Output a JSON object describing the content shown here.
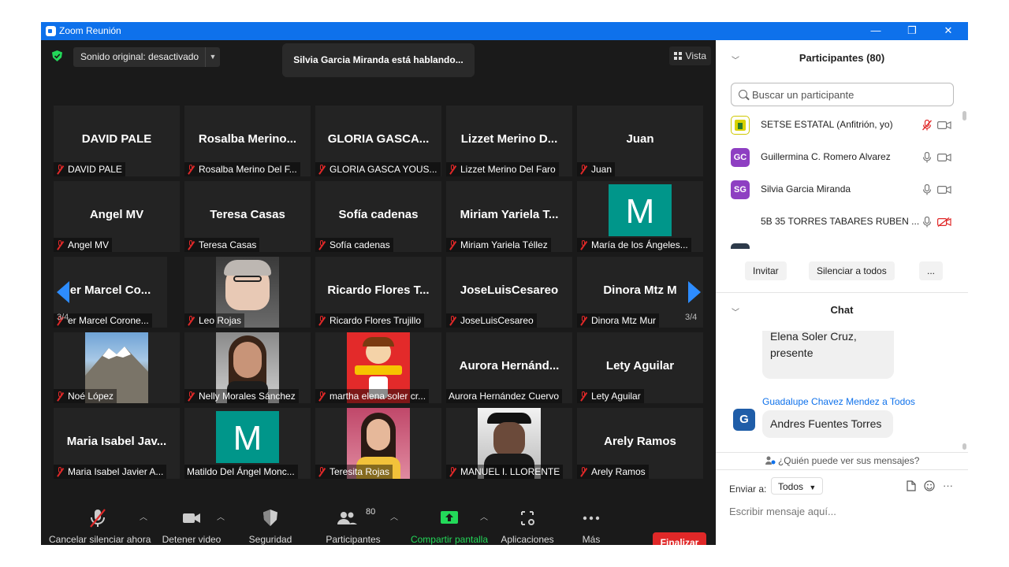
{
  "window": {
    "title": "Zoom Reunión",
    "minimize": "—",
    "maximize": "❐",
    "close": "✕"
  },
  "top": {
    "audio_label": "Sonido original: desactivado",
    "speaking": "Silvia Garcia Miranda está hablando...",
    "view_label": "Vista"
  },
  "tiles": [
    {
      "big": "DAVID PALE",
      "label": "DAVID PALE"
    },
    {
      "big": "Rosalba  Merino...",
      "label": "Rosalba Merino Del F..."
    },
    {
      "big": "GLORIA GASCA...",
      "label": "GLORIA GASCA YOUS..."
    },
    {
      "big": "Lizzet  Merino  D...",
      "label": "Lizzet Merino Del Faro"
    },
    {
      "big": "Juan",
      "label": "Juan"
    },
    {
      "big": "Angel MV",
      "label": "Angel MV"
    },
    {
      "big": "Teresa Casas",
      "label": "Teresa Casas"
    },
    {
      "big": "Sofía cadenas",
      "label": "Sofía cadenas"
    },
    {
      "big": "Miriam  Yariela  T...",
      "label": "Miriam Yariela Téllez"
    },
    {
      "letter": "M",
      "label": "María de los Ángeles..."
    },
    {
      "big": "er  Marcel  Co...",
      "label": "er Marcel Corone..."
    },
    {
      "photo": "leo",
      "label": "Leo Rojas"
    },
    {
      "big": "Ricardo  Flores  T...",
      "label": "Ricardo Flores Trujillo"
    },
    {
      "big": "JoseLuisCesareo",
      "label": "JoseLuisCesareo"
    },
    {
      "big": "Dinora  Mtz  M",
      "label": "Dinora Mtz Mur"
    },
    {
      "photo": "mountain",
      "label": "Noé López"
    },
    {
      "photo": "nelly",
      "label": "Nelly Morales Sánchez"
    },
    {
      "photo": "martha",
      "label": "martha elena soler cr..."
    },
    {
      "big": "Aurora  Hernánd...",
      "label": "Aurora Hernández Cuervo",
      "unmuted": true
    },
    {
      "big": "Lety Aguilar",
      "label": "Lety Aguilar"
    },
    {
      "big": "Maria  Isabel  Jav...",
      "label": "Maria Isabel Javier A..."
    },
    {
      "letter": "M",
      "label": "Matildo Del Ángel Monc...",
      "unmuted": true
    },
    {
      "photo": "teresita",
      "label": "Teresita Rojas"
    },
    {
      "photo": "manuel",
      "label": "MANUEL I. LLORENTE"
    },
    {
      "big": "Arely Ramos",
      "label": "Arely Ramos"
    }
  ],
  "pages": {
    "left": "3/4",
    "right": "3/4"
  },
  "toolbar": {
    "unmute": "Cancelar silenciar ahora",
    "video": "Detener video",
    "security": "Seguridad",
    "participants": "Participantes",
    "participants_count": "80",
    "share": "Compartir pantalla",
    "apps": "Aplicaciones",
    "more": "Más",
    "end": "Finalizar"
  },
  "participants_panel": {
    "title": "Participantes (80)",
    "search_placeholder": "Buscar un participante",
    "list": [
      {
        "initials": "",
        "name": "SETSE ESTATAL (Anfitrión, yo)",
        "color": "#d9d200"
      },
      {
        "initials": "GC",
        "name": "Guillermina C. Romero Alvarez",
        "color": "#8e3fc2"
      },
      {
        "initials": "SG",
        "name": "Silvia Garcia Miranda",
        "color": "#8e3fc2"
      },
      {
        "initials": "",
        "name": "5B 35 TORRES TABARES RUBEN ...",
        "color": "#ffffff"
      }
    ],
    "invite": "Invitar",
    "mute_all": "Silenciar a todos",
    "more": "..."
  },
  "chat": {
    "title": "Chat",
    "prev_message_line1": "Elena Soler Cruz,",
    "prev_message_line2": "presente",
    "sender": "Guadalupe Chavez Mendez a Todos",
    "sender_initial": "G",
    "message": "Andres Fuentes Torres",
    "who_can_see": "¿Quién puede ver sus mensajes?",
    "send_to_label": "Enviar a:",
    "send_to_value": "Todos",
    "compose_placeholder": "Escribir mensaje aquí..."
  },
  "colors": {
    "titlebar": "#0e71eb",
    "share_green": "#23d959",
    "end_red": "#e02828",
    "muted_red": "#e02828"
  }
}
